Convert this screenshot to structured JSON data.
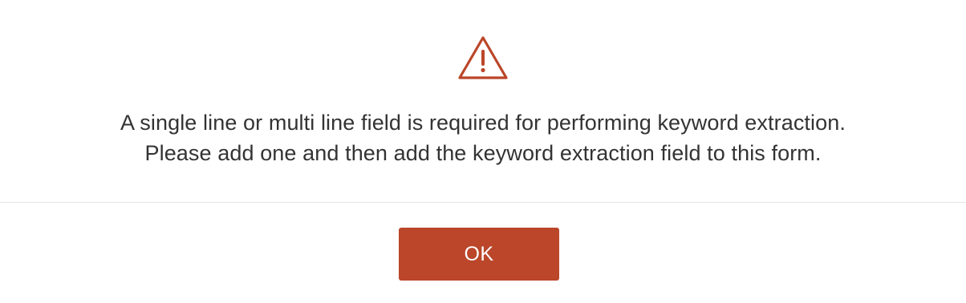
{
  "dialog": {
    "icon": "warning-triangle-icon",
    "message_lines": [
      "A single line or multi line field is required for performing keyword extraction.",
      "Please add one and then add the keyword extraction field to this form."
    ],
    "ok_label": "OK"
  },
  "colors": {
    "accent": "#bb462a",
    "text": "#333333",
    "divider": "#e6e6e6"
  }
}
